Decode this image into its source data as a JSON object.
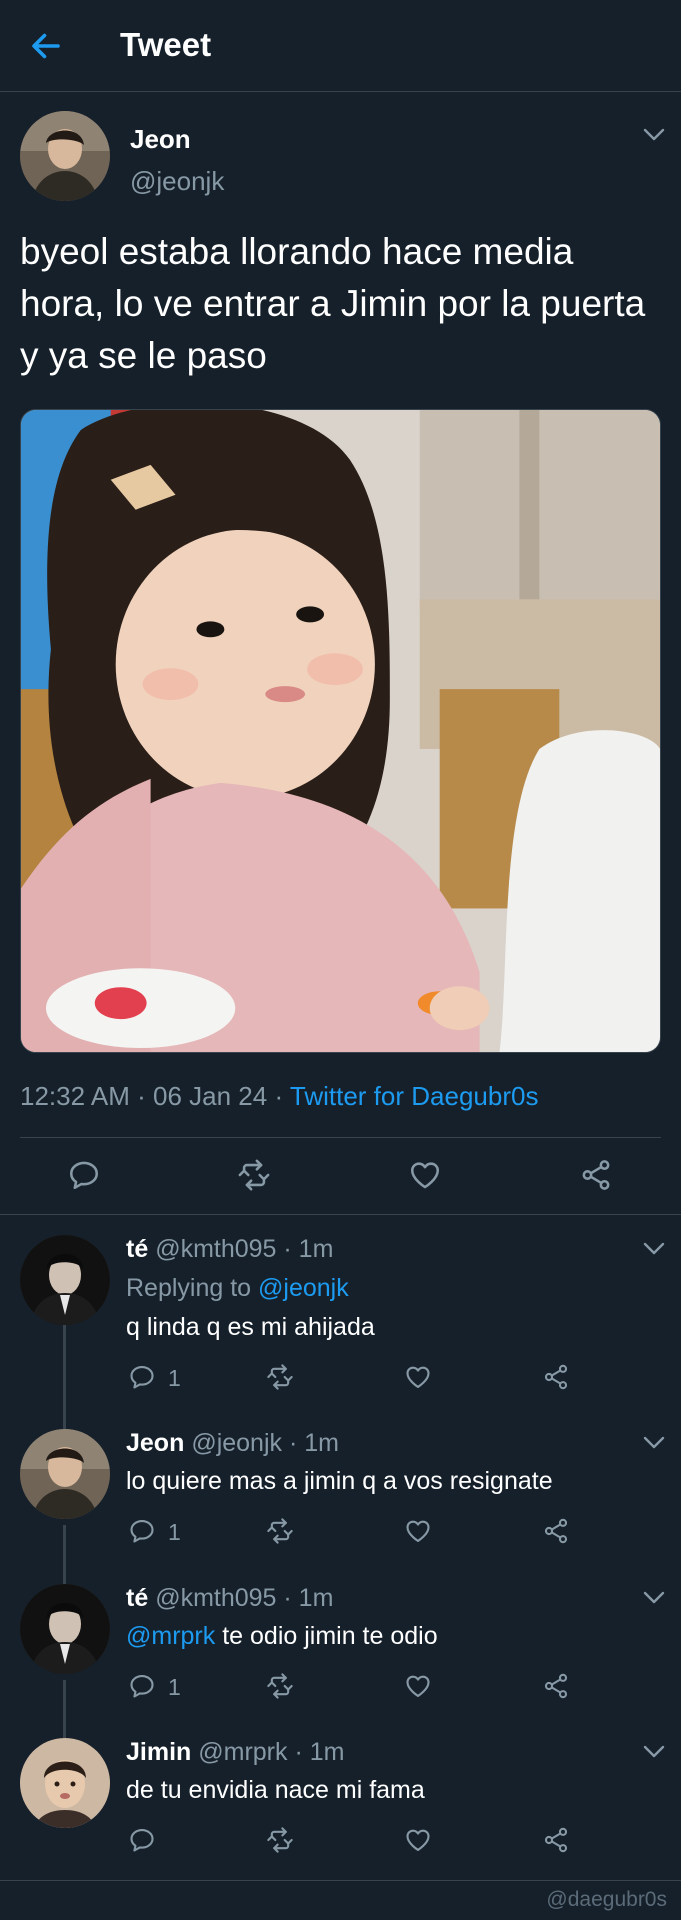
{
  "header": {
    "title": "Tweet",
    "back_icon": "arrow-left-icon"
  },
  "colors": {
    "background": "#15202b",
    "accent": "#1d9bf0",
    "secondary_text": "#8899a6",
    "divider": "#38444d"
  },
  "tweet": {
    "name": "Jeon",
    "handle": "@jeonjk",
    "text": "byeol estaba llorando hace media hora, lo ve entrar a Jimin por la puerta y ya se le paso",
    "time": "12:32 AM",
    "dot1": "·",
    "date": "06 Jan 24",
    "dot2": "·",
    "source": "Twitter for Daegubr0s",
    "actions": [
      "reply-icon",
      "retweet-icon",
      "like-icon",
      "share-icon"
    ]
  },
  "replies": [
    {
      "name": "té",
      "handle": "@kmth095",
      "time": "· 1m",
      "replying_prefix": "Replying to ",
      "replying_to": "@jeonjk",
      "text": "q linda q es mi ahijada",
      "reply_count": "1"
    },
    {
      "name": "Jeon",
      "handle": "@jeonjk",
      "time": "· 1m",
      "text": "lo quiere mas a jimin q a vos resignate",
      "reply_count": "1"
    },
    {
      "name": "té",
      "handle": "@kmth095",
      "time": "· 1m",
      "mention": "@mrprk",
      "text": " te odio jimin te odio",
      "reply_count": "1"
    },
    {
      "name": "Jimin",
      "handle": "@mrprk",
      "time": "· 1m",
      "text": "de tu envidia nace mi fama",
      "reply_count": ""
    }
  ],
  "watermark": "@daegubr0s"
}
